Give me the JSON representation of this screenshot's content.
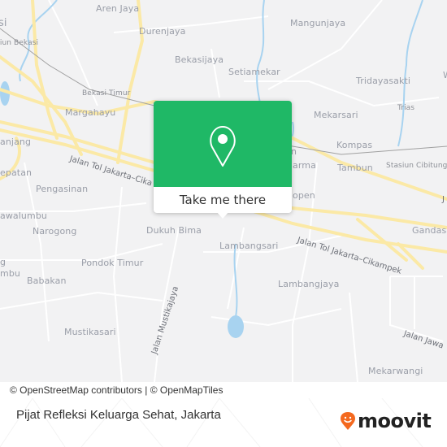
{
  "map": {
    "places": [
      {
        "name": "Aren Jaya",
        "size": "normal"
      },
      {
        "name": "Durenjaya",
        "size": "normal"
      },
      {
        "name": "Bekasijaya",
        "size": "normal"
      },
      {
        "name": "Setiamekar",
        "size": "normal"
      },
      {
        "name": "Mangunjaya",
        "size": "normal"
      },
      {
        "name": "Tridayasakti",
        "size": "normal"
      },
      {
        "name": "Trias",
        "size": "small"
      },
      {
        "name": "Mekarsari",
        "size": "normal"
      },
      {
        "name": "Kompas",
        "size": "normal"
      },
      {
        "name": "Tambun",
        "size": "normal"
      },
      {
        "name": "Stasiun Cibitung",
        "size": "small"
      },
      {
        "name": "Bekasi Timur",
        "size": "small"
      },
      {
        "name": "Margahayu",
        "size": "normal"
      },
      {
        "name": "Stasiun Bekasi",
        "size": "small"
      },
      {
        "name": "si",
        "size": "normal"
      },
      {
        "name": "anjang",
        "size": "normal"
      },
      {
        "name": "epatan",
        "size": "normal"
      },
      {
        "name": "Pengasinan",
        "size": "normal"
      },
      {
        "name": "awalumbu",
        "size": "normal"
      },
      {
        "name": "Narogong",
        "size": "normal"
      },
      {
        "name": "g",
        "size": "normal"
      },
      {
        "name": "mbu",
        "size": "normal"
      },
      {
        "name": "Pondok Timur",
        "size": "normal"
      },
      {
        "name": "Babakan",
        "size": "normal"
      },
      {
        "name": "Dukuh Bima",
        "size": "normal"
      },
      {
        "name": "Lambangsari",
        "size": "normal"
      },
      {
        "name": "Lambangjaya",
        "size": "normal"
      },
      {
        "name": "Mustikasari",
        "size": "normal"
      },
      {
        "name": "Mekarwangi",
        "size": "normal"
      },
      {
        "name": "Gandasa",
        "size": "normal"
      },
      {
        "name": "arma",
        "size": "normal"
      },
      {
        "name": "open",
        "size": "normal"
      },
      {
        "name": "W",
        "size": "normal"
      },
      {
        "name": "n",
        "size": "normal"
      }
    ],
    "roads": [
      {
        "name": "Jalan Tol Jakarta–Cika"
      },
      {
        "name": "Jalan Tol Jakarta–Cikampek"
      },
      {
        "name": "Jalan Mustikajaya"
      },
      {
        "name": "Jalan Jawa"
      },
      {
        "name": "J"
      }
    ],
    "colors": {
      "land": "#f2f2f3",
      "major_road": "#fbe9a6",
      "minor_road": "#ffffff",
      "water": "#a8d3f0",
      "rail": "#9a9a9a"
    }
  },
  "popup": {
    "icon": "map-pin-icon",
    "action_label": "Take me there",
    "accent_color": "#1fb866"
  },
  "attribution": "© OpenStreetMap contributors | © OpenMapTiles",
  "footer": {
    "title": "Pijat Refleksi Keluarga Sehat, Jakarta",
    "logo_text": "moovit",
    "logo_color": "#f4691f"
  }
}
